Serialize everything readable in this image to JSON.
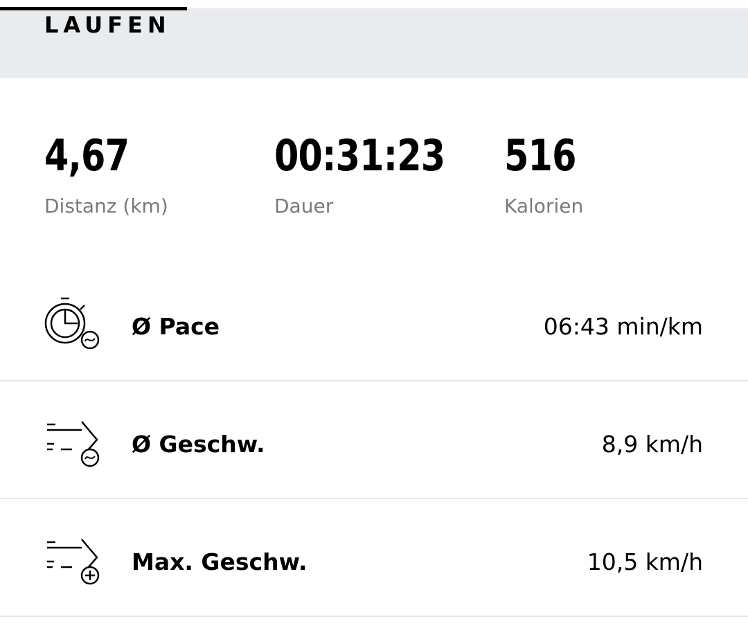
{
  "header": {
    "tab_label": "LAUFEN"
  },
  "summary": {
    "distance": {
      "value": "4,67",
      "label": "Distanz (km)"
    },
    "duration": {
      "value": "00:31:23",
      "label": "Dauer"
    },
    "calories": {
      "value": "516",
      "label": "Kalorien"
    }
  },
  "metrics": [
    {
      "icon": "stopwatch-average-icon",
      "label": "Ø Pace",
      "value": "06:43 min/km"
    },
    {
      "icon": "speed-average-icon",
      "label": "Ø Geschw.",
      "value": "8,9 km/h"
    },
    {
      "icon": "speed-max-icon",
      "label": "Max. Geschw.",
      "value": "10,5 km/h"
    }
  ],
  "colors": {
    "header_background": "#e9ecef",
    "text_primary": "#000000",
    "text_secondary": "#7a7a7a",
    "divider": "#e5e8ea"
  }
}
